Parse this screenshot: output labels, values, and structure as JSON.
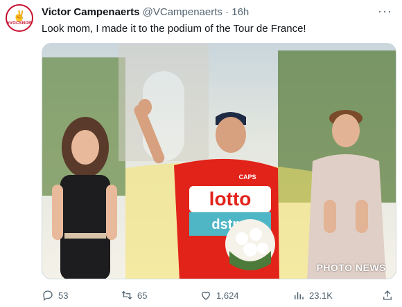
{
  "avatar": {
    "hand": "✌",
    "tag": "#VOCSNOR"
  },
  "tweet": {
    "author_name": "Victor Campenaerts",
    "handle": "@VCampenaerts",
    "separator": "·",
    "time": "16h",
    "text": "Look mom, I made it to the podium of the Tour de France!"
  },
  "photo": {
    "watermark": "PHOTO NEWS",
    "jersey_brand": "lotto",
    "jersey_brand_2": "dstny",
    "jersey_sponsor": "CAPS"
  },
  "actions": {
    "replies": "53",
    "retweets": "65",
    "likes": "1,624",
    "views": "23.1K"
  },
  "colors": {
    "accent_red": "#e2231a",
    "muted": "#536471",
    "text": "#0f1419"
  }
}
